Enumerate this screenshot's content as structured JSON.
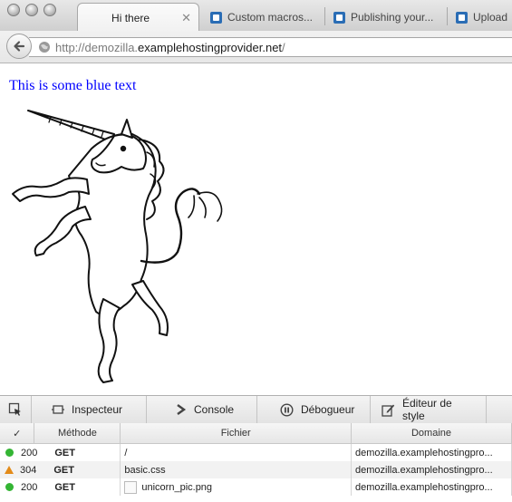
{
  "browser": {
    "tabs": [
      {
        "title": "Hi there",
        "active": true
      },
      {
        "title": "Custom macros...",
        "active": false
      },
      {
        "title": "Publishing your...",
        "active": false
      },
      {
        "title": "Upload",
        "active": false
      }
    ],
    "url": {
      "prefix": "http://demozilla.",
      "domain": "examplehostingprovider.net",
      "suffix": "/"
    }
  },
  "page": {
    "blue_text": "This is some blue text",
    "blue_text_color": "#0000ff",
    "image": "unicorn-illustration"
  },
  "devtools": {
    "tabs": [
      {
        "label": "Inspecteur",
        "icon": "inspector-icon"
      },
      {
        "label": "Console",
        "icon": "console-icon"
      },
      {
        "label": "Débogueur",
        "icon": "debugger-icon"
      },
      {
        "label": "Éditeur de style",
        "icon": "style-editor-icon"
      }
    ],
    "network": {
      "columns": {
        "check": "✓",
        "method": "Méthode",
        "file": "Fichier",
        "domain": "Domaine"
      },
      "rows": [
        {
          "status": "200",
          "status_type": "success",
          "method": "GET",
          "file": "/",
          "domain": "demozilla.examplehostingpro..."
        },
        {
          "status": "304",
          "status_type": "warning",
          "method": "GET",
          "file": "basic.css",
          "domain": "demozilla.examplehostingpro..."
        },
        {
          "status": "200",
          "status_type": "success",
          "method": "GET",
          "file": "unicorn_pic.png",
          "domain": "demozilla.examplehostingpro..."
        }
      ]
    }
  }
}
